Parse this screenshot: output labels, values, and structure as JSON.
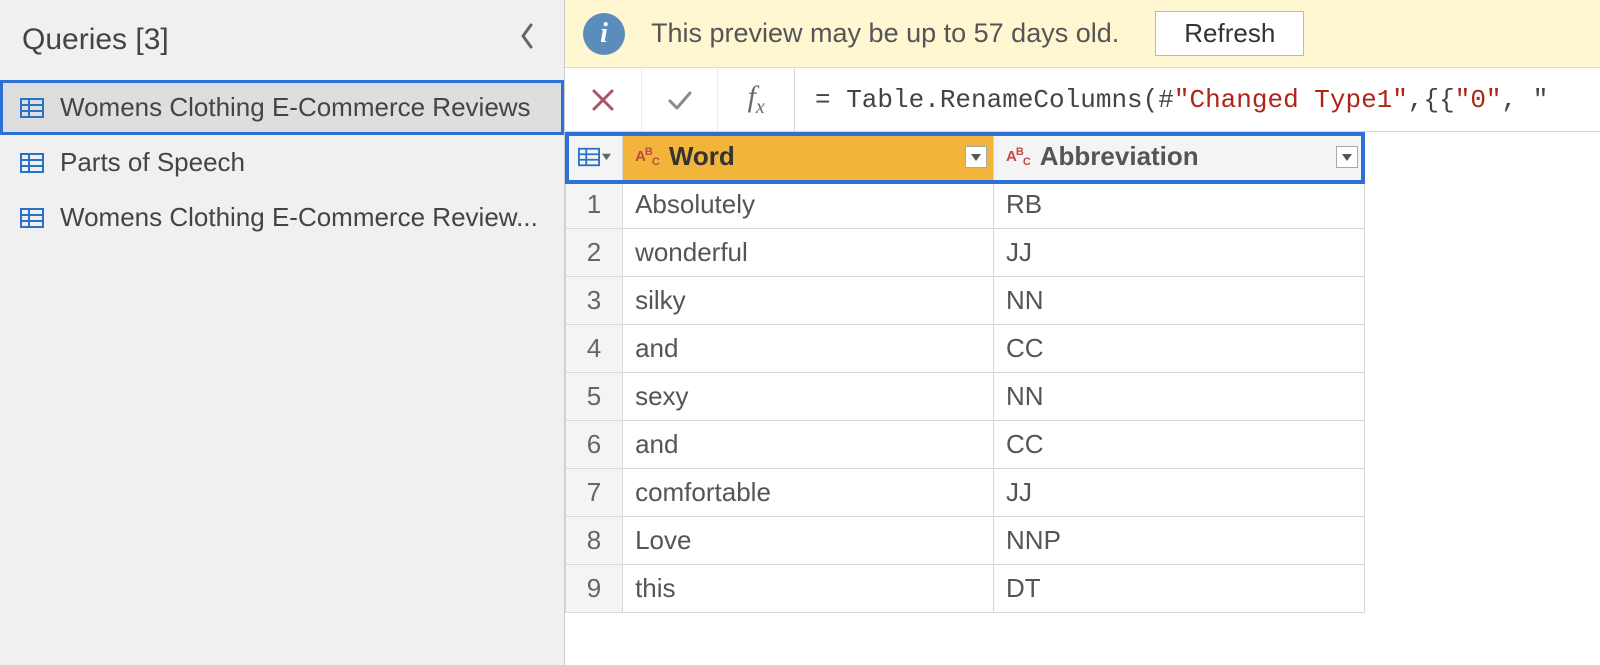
{
  "sidebar": {
    "title": "Queries [3]",
    "items": [
      {
        "label": "Womens Clothing E-Commerce Reviews",
        "selected": true
      },
      {
        "label": "Parts of Speech",
        "selected": false
      },
      {
        "label": "Womens Clothing E-Commerce Review...",
        "selected": false
      }
    ]
  },
  "banner": {
    "text": "This preview may be up to 57 days old.",
    "refresh_label": "Refresh"
  },
  "formula_bar": {
    "prefix": "= Table.RenameColumns(#",
    "string1": "\"Changed Type1\"",
    "mid": ",{{",
    "string2": "\"0\"",
    "tail": ", \""
  },
  "columns": [
    {
      "name": "Word",
      "active": true
    },
    {
      "name": "Abbreviation",
      "active": false
    }
  ],
  "rows": [
    {
      "n": "1",
      "word": "Absolutely",
      "abbr": "RB"
    },
    {
      "n": "2",
      "word": "wonderful",
      "abbr": "JJ"
    },
    {
      "n": "3",
      "word": "silky",
      "abbr": "NN"
    },
    {
      "n": "4",
      "word": "and",
      "abbr": "CC"
    },
    {
      "n": "5",
      "word": "sexy",
      "abbr": "NN"
    },
    {
      "n": "6",
      "word": "and",
      "abbr": "CC"
    },
    {
      "n": "7",
      "word": "comfortable",
      "abbr": "JJ"
    },
    {
      "n": "8",
      "word": "Love",
      "abbr": "NNP"
    },
    {
      "n": "9",
      "word": "this",
      "abbr": "DT"
    }
  ]
}
